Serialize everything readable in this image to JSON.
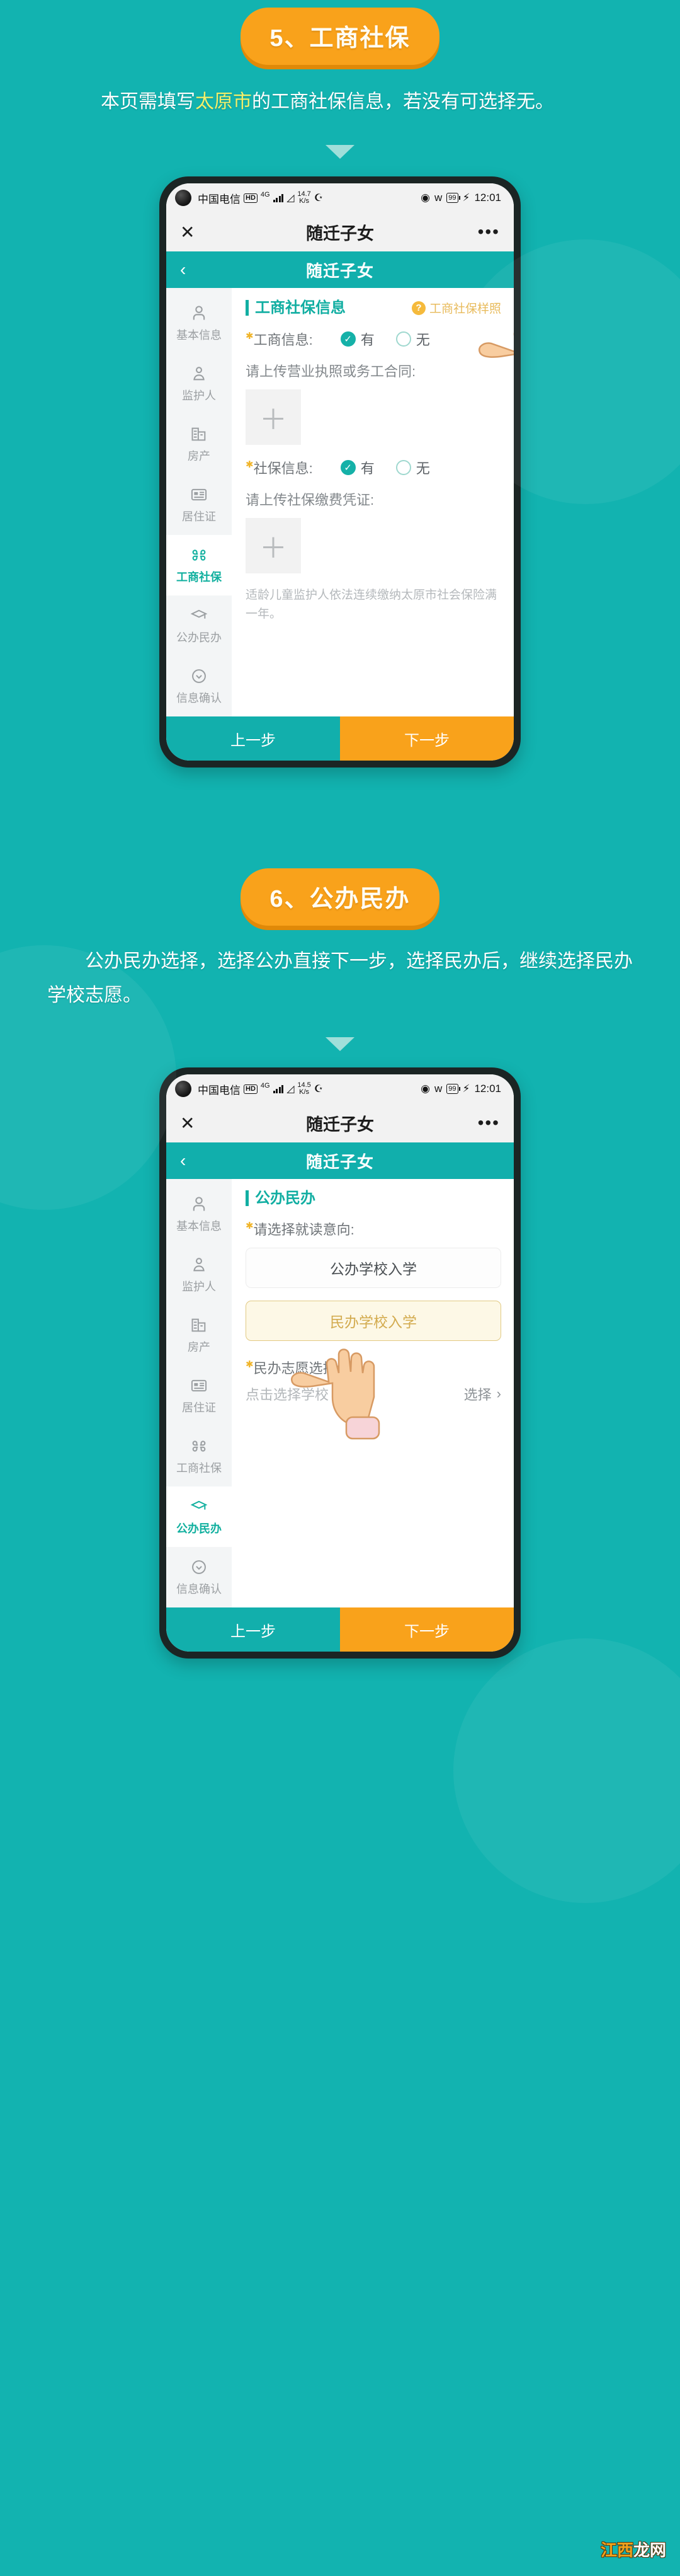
{
  "theme": {
    "teal": "#12b3b0",
    "orange": "#f9a21b",
    "yellow_text": "#f3ef6a"
  },
  "sections": [
    {
      "badge": "5、工商社保",
      "desc_pre": "本页需填写",
      "desc_hl": "太原市",
      "desc_post": "的工商社保信息，若没有可选择无。",
      "phone": {
        "status": {
          "carrier": "中国电信",
          "hd": "HD",
          "net": "4G",
          "speed_value": "14.7",
          "speed_unit": "K/s",
          "battery": "99",
          "time": "12:01"
        },
        "appbar": {
          "close": "✕",
          "title": "随迁子女",
          "more": "•••"
        },
        "navbar": {
          "back": "‹",
          "title": "随迁子女"
        },
        "sidebar": [
          {
            "label": "基本信息",
            "icon": "person-icon",
            "active": false
          },
          {
            "label": "监护人",
            "icon": "guardian-icon",
            "active": false
          },
          {
            "label": "房产",
            "icon": "building-icon",
            "active": false
          },
          {
            "label": "居住证",
            "icon": "id-card-icon",
            "active": false
          },
          {
            "label": "工商社保",
            "icon": "grid-flower-icon",
            "active": true
          },
          {
            "label": "公办民办",
            "icon": "graduation-cap-icon",
            "active": false
          },
          {
            "label": "信息确认",
            "icon": "check-circle-icon",
            "active": false
          }
        ],
        "form": {
          "section_title": "工商社保信息",
          "sample_link": "工商社保样照",
          "field1_label": "工商信息:",
          "field1_yes": "有",
          "field1_no": "无",
          "field1_selected": "有",
          "upload1_label": "请上传营业执照或务工合同:",
          "upload_plus": "＋",
          "field2_label": "社保信息:",
          "field2_yes": "有",
          "field2_no": "无",
          "field2_selected": "有",
          "upload2_label": "请上传社保缴费凭证:",
          "hint": "适龄儿童监护人依法连续缴纳太原市社会保险满一年。"
        },
        "footer": {
          "prev": "上一步",
          "next": "下一步"
        }
      }
    },
    {
      "badge": "6、公办民办",
      "desc_full": "公办民办选择，选择公办直接下一步，选择民办后，继续选择民办学校志愿。",
      "phone": {
        "status": {
          "carrier": "中国电信",
          "hd": "HD",
          "net": "4G",
          "speed_value": "14.5",
          "speed_unit": "K/s",
          "battery": "99",
          "time": "12:01"
        },
        "appbar": {
          "close": "✕",
          "title": "随迁子女",
          "more": "•••"
        },
        "navbar": {
          "back": "‹",
          "title": "随迁子女"
        },
        "sidebar": [
          {
            "label": "基本信息",
            "icon": "person-icon",
            "active": false
          },
          {
            "label": "监护人",
            "icon": "guardian-icon",
            "active": false
          },
          {
            "label": "房产",
            "icon": "building-icon",
            "active": false
          },
          {
            "label": "居住证",
            "icon": "id-card-icon",
            "active": false
          },
          {
            "label": "工商社保",
            "icon": "grid-flower-icon",
            "active": false
          },
          {
            "label": "公办民办",
            "icon": "graduation-cap-icon",
            "active": true
          },
          {
            "label": "信息确认",
            "icon": "check-circle-icon",
            "active": false
          }
        ],
        "form": {
          "section_title": "公办民办",
          "intent_label": "请选择就读意向:",
          "option_public": "公办学校入学",
          "option_private": "民办学校入学",
          "selected_option": "民办学校入学",
          "volunteer_label": "民办志愿选择:",
          "school_placeholder": "点击选择学校",
          "select_action": "选择",
          "chevron": "›"
        },
        "footer": {
          "prev": "上一步",
          "next": "下一步"
        }
      }
    }
  ],
  "watermark": {
    "a": "江西",
    "b": "龙网"
  }
}
